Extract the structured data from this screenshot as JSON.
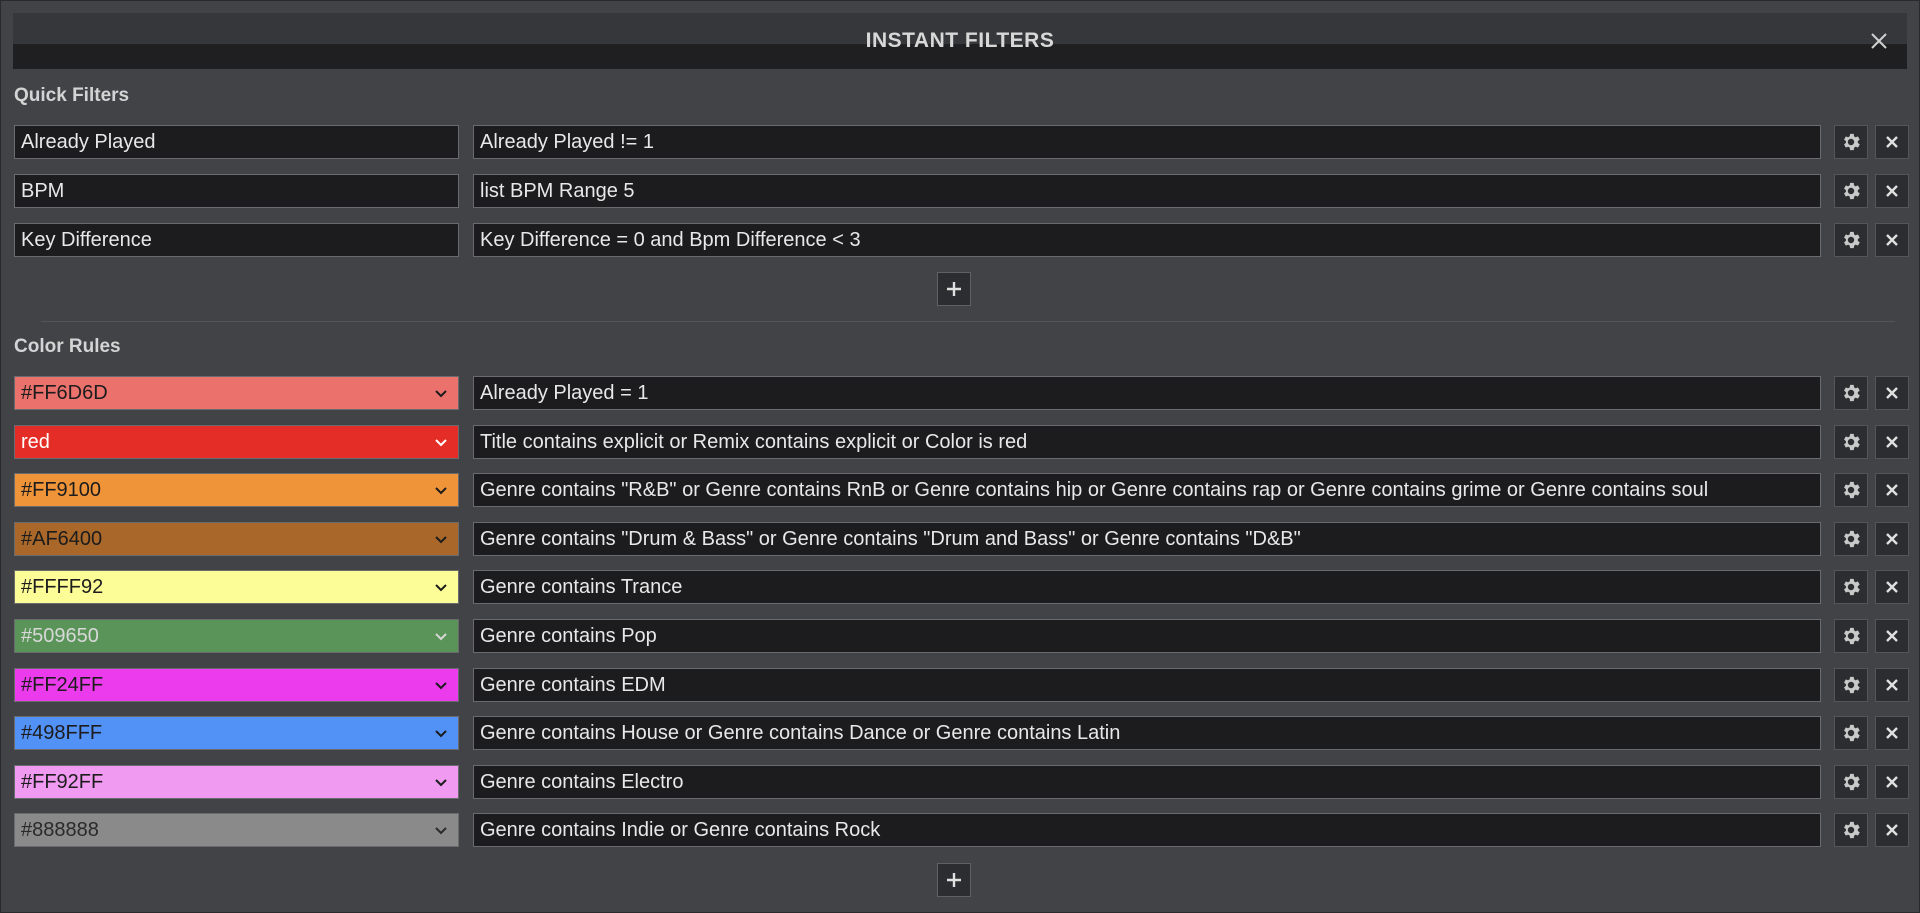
{
  "dialog": {
    "title": "INSTANT FILTERS"
  },
  "quick_filters": {
    "heading": "Quick Filters",
    "rows": [
      {
        "name": "Already Played",
        "expression": "Already Played != 1"
      },
      {
        "name": "BPM",
        "expression": "list BPM Range 5"
      },
      {
        "name": "Key Difference",
        "expression": "Key Difference = 0 and Bpm Difference < 3"
      }
    ]
  },
  "color_rules": {
    "heading": "Color Rules",
    "rows": [
      {
        "color_label": "#FF6D6D",
        "bg": "#ea716c",
        "fg": "#1c1c1c",
        "expression": "Already Played = 1"
      },
      {
        "color_label": "red",
        "bg": "#e52d27",
        "fg": "#ffffff",
        "expression": "Title contains explicit or Remix contains explicit or Color is red"
      },
      {
        "color_label": "#FF9100",
        "bg": "#f0943a",
        "fg": "#1c1c1c",
        "expression": "Genre contains \"R&B\" or Genre contains RnB or Genre contains hip or Genre contains rap or Genre contains grime or Genre contains soul"
      },
      {
        "color_label": "#AF6400",
        "bg": "#a96829",
        "fg": "#1c1c1c",
        "expression": "Genre contains \"Drum & Bass\" or Genre contains \"Drum and Bass\" or Genre contains \"D&B\""
      },
      {
        "color_label": "#FFFF92",
        "bg": "#fdfd98",
        "fg": "#1c1c1c",
        "expression": "Genre contains Trance"
      },
      {
        "color_label": "#509650",
        "bg": "#5a9458",
        "fg": "#d8d8d8",
        "expression": "Genre contains Pop"
      },
      {
        "color_label": "#FF24FF",
        "bg": "#ec3bec",
        "fg": "#1c1c1c",
        "expression": "Genre contains EDM"
      },
      {
        "color_label": "#498FFF",
        "bg": "#5291f6",
        "fg": "#1c1c1c",
        "expression": "Genre contains House or Genre contains Dance or Genre contains Latin"
      },
      {
        "color_label": "#FF92FF",
        "bg": "#f19af2",
        "fg": "#1c1c1c",
        "expression": "Genre contains Electro"
      },
      {
        "color_label": "#888888",
        "bg": "#8a8a8a",
        "fg": "#2a2a2a",
        "expression": "Genre contains Indie or Genre contains Rock"
      }
    ]
  },
  "icons": {
    "close": "close-icon",
    "gear": "gear-icon",
    "delete": "x-icon",
    "add": "plus-icon",
    "dropdown": "chevron-down-icon"
  }
}
